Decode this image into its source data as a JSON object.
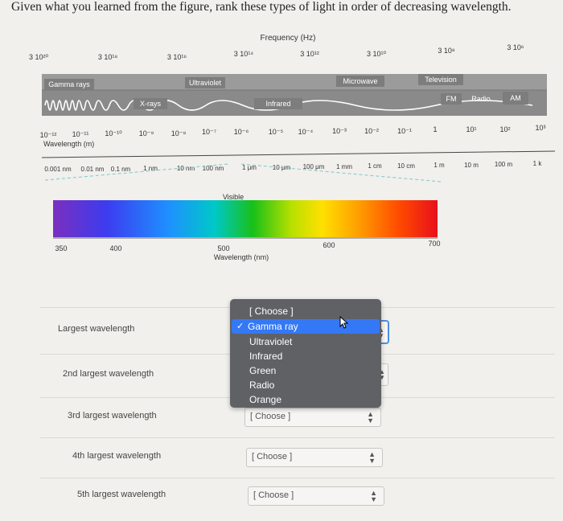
{
  "question": "Given what you learned from the figure, rank these types of light in order of decreasing wavelength.",
  "figure": {
    "frequency_title": "Frequency (Hz)",
    "frequency_ticks": [
      "3 10²⁰",
      "3 10¹⁸",
      "3 10¹⁶",
      "3 10¹⁴",
      "3 10¹²",
      "3 10¹⁰",
      "3 10⁸",
      "3 10⁶"
    ],
    "band_labels": {
      "gamma": "Gamma rays",
      "xray": "X-rays",
      "uv": "Ultraviolet",
      "ir": "Infrared",
      "microwave": "Microwave",
      "tv": "Television",
      "fm": "FM",
      "radio": "Radio",
      "am": "AM"
    },
    "wavelength_ticks_m": [
      "10⁻¹²",
      "10⁻¹¹",
      "10⁻¹⁰",
      "10⁻⁹",
      "10⁻⁸",
      "10⁻⁷",
      "10⁻⁶",
      "10⁻⁵",
      "10⁻⁴",
      "10⁻³",
      "10⁻²",
      "10⁻¹",
      "1",
      "10¹",
      "10²",
      "10³"
    ],
    "wavelength_title": "Wavelength (m)",
    "unit_ticks": [
      "0.001 nm",
      "0.01 nm",
      "0.1 nm",
      "1 nm",
      "10 nm",
      "100 nm",
      "1 μm",
      "10 μm",
      "100 μm",
      "1 mm",
      "1 cm",
      "10 cm",
      "1 m",
      "10 m",
      "100 m",
      "1 k"
    ],
    "visible_label": "Visible",
    "visible_ticks": [
      "350",
      "400",
      "500",
      "600",
      "700"
    ],
    "visible_axis_title": "Wavelength (nm)"
  },
  "rows": [
    {
      "label": "Largest wavelength",
      "value": "[ Choose ]"
    },
    {
      "label": "2nd largest wavelength",
      "value": "[ Choose ]"
    },
    {
      "label": "3rd largest wavelength",
      "value": "[ Choose ]"
    },
    {
      "label": "4th largest wavelength",
      "value": "[ Choose ]"
    },
    {
      "label": "5th largest wavelength",
      "value": "[ Choose ]"
    }
  ],
  "dropdown": {
    "options": [
      "[ Choose ]",
      "Gamma ray",
      "Ultraviolet",
      "Infrared",
      "Green",
      "Radio",
      "Orange"
    ],
    "selected_index": 1,
    "check_mark": "✓"
  },
  "colors": {
    "selected": "#3478f6",
    "menu_bg": "#5f6165",
    "focus_border": "#4a90e2"
  }
}
